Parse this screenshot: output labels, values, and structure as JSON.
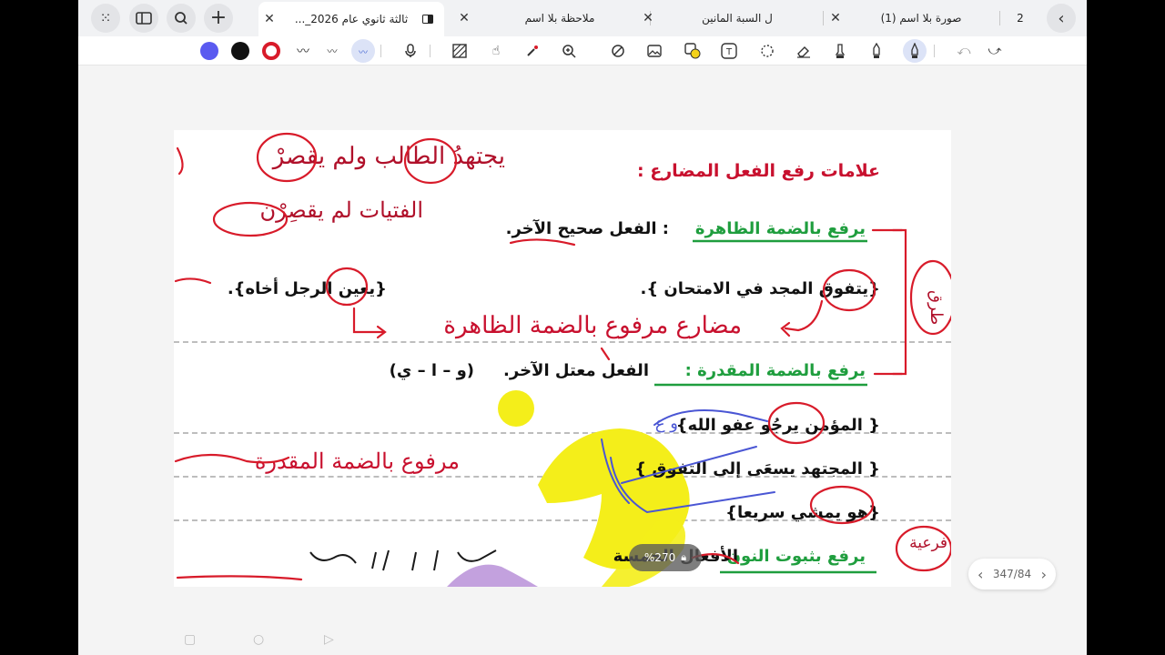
{
  "tabs": [
    {
      "title": "ثالثة ثانوي عام 2026_...",
      "active": true
    },
    {
      "title": "ملاحظة بلا اسم",
      "active": false
    },
    {
      "title": "ل السبة المانين",
      "active": false
    },
    {
      "title": "صورة بلا اسم (1)",
      "active": false
    },
    {
      "title": "2",
      "active": false
    }
  ],
  "toolbar": {
    "swatches": [
      "#5a5af0",
      "#111111",
      "#d81b2a"
    ],
    "icons": [
      "pen-style-1",
      "pen-style-2",
      "pen-style-3",
      "microphone",
      "hatch",
      "touch-off",
      "magic-eraser",
      "zoom-in",
      "shape",
      "image",
      "sticker",
      "text-box",
      "lasso",
      "eraser",
      "highlighter",
      "marker",
      "pen",
      "undo",
      "redo"
    ]
  },
  "page": {
    "heading": "علامات رفع الفعل المضارع :",
    "rules": [
      {
        "label": "يرفع بالضمة الظاهرة",
        "desc": ": الفعل صحيح الآخر."
      },
      {
        "label": "يرفع بالضمة المقدرة :",
        "desc": "الفعل معتل الآخر.",
        "letters": "(و – ا – ي)"
      },
      {
        "label": "يرفع بثبوت النون",
        "desc": "الأفعال الخمسة"
      }
    ],
    "examples": {
      "e1": "{يتفوق المجد في الامتحان }.",
      "e2": "{يعين الرجل أخاه}.",
      "e3": "{ المؤمن يرجُو عفو الله}",
      "e4": "{ المجتهد يسعَى إلى التفوق }",
      "e5": "{هو يمشي سريعا}"
    },
    "handwriting": {
      "h1": "يجتهدُ الطالب ولم يقصرْ",
      "h2": "الفتيات لم يقصِرْن",
      "h3": "مضارع مرفوع بالضمة الظاهرة",
      "h4": "مرفوع بالضمة المقدرة",
      "h5": "فرعية",
      "h6": "طرق",
      "h7": "و ع"
    }
  },
  "zoom": {
    "label": "%270"
  },
  "pager": {
    "label": "347/84"
  },
  "colors": {
    "heading": "#c8102e",
    "rule": "#1f9e3e",
    "ink": "#d81b2a",
    "blue_ink": "#4a56d4",
    "highlight": "#f4ee1a"
  }
}
